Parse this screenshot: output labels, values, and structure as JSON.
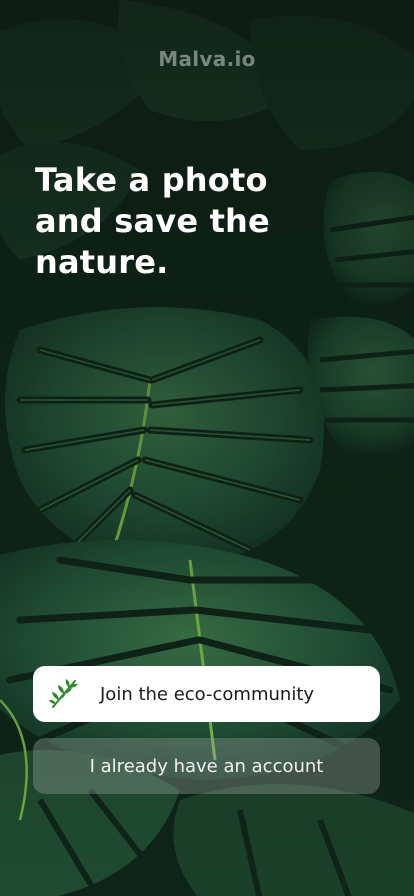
{
  "brand": "Malva.io",
  "headline": "Take a photo and save the nature.",
  "buttons": {
    "join_label": "Join the eco-community",
    "login_label": "I already have an account"
  },
  "icons": {
    "join_icon": "leaf-branch-icon"
  },
  "colors": {
    "leaf_green": "#2f8a2a",
    "primary_button_bg": "#ffffff",
    "headline_text": "#ffffff"
  }
}
